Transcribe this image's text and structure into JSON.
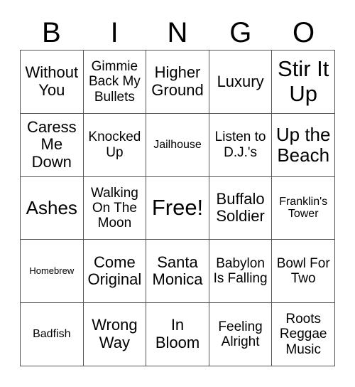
{
  "card": {
    "header_letters": [
      "B",
      "I",
      "N",
      "G",
      "O"
    ],
    "grid": {
      "rows": 5,
      "columns": 5,
      "border_color": "#555555",
      "background_color": "#ffffff",
      "text_color": "#000000"
    },
    "cells": [
      {
        "text": "Without You",
        "size": "l",
        "row": 1,
        "column": "B"
      },
      {
        "text": "Gimmie Back My Bullets",
        "size": "m",
        "row": 1,
        "column": "I"
      },
      {
        "text": "Higher Ground",
        "size": "l",
        "row": 1,
        "column": "N"
      },
      {
        "text": "Luxury",
        "size": "l",
        "row": 1,
        "column": "G"
      },
      {
        "text": "Stir It Up",
        "size": "xxl",
        "row": 1,
        "column": "O"
      },
      {
        "text": "Caress Me Down",
        "size": "l",
        "row": 2,
        "column": "B"
      },
      {
        "text": "Knocked Up",
        "size": "m",
        "row": 2,
        "column": "I"
      },
      {
        "text": "Jailhouse",
        "size": "s",
        "row": 2,
        "column": "N"
      },
      {
        "text": "Listen to D.J.'s",
        "size": "m",
        "row": 2,
        "column": "G"
      },
      {
        "text": "Up the Beach",
        "size": "xl",
        "row": 2,
        "column": "O"
      },
      {
        "text": "Ashes",
        "size": "xl",
        "row": 3,
        "column": "B"
      },
      {
        "text": "Walking On The Moon",
        "size": "m",
        "row": 3,
        "column": "I"
      },
      {
        "text": "Free!",
        "size": "free",
        "row": 3,
        "column": "N"
      },
      {
        "text": "Buffalo Soldier",
        "size": "l",
        "row": 3,
        "column": "G"
      },
      {
        "text": "Franklin's Tower",
        "size": "s",
        "row": 3,
        "column": "O"
      },
      {
        "text": "Homebrew",
        "size": "xs",
        "row": 4,
        "column": "B"
      },
      {
        "text": "Come Original",
        "size": "l",
        "row": 4,
        "column": "I"
      },
      {
        "text": "Santa Monica",
        "size": "l",
        "row": 4,
        "column": "N"
      },
      {
        "text": "Babylon Is Falling",
        "size": "m",
        "row": 4,
        "column": "G"
      },
      {
        "text": "Bowl For Two",
        "size": "m",
        "row": 4,
        "column": "O"
      },
      {
        "text": "Badfish",
        "size": "s",
        "row": 5,
        "column": "B"
      },
      {
        "text": "Wrong Way",
        "size": "l",
        "row": 5,
        "column": "I"
      },
      {
        "text": "In Bloom",
        "size": "l",
        "row": 5,
        "column": "N"
      },
      {
        "text": "Feeling Alright",
        "size": "m",
        "row": 5,
        "column": "G"
      },
      {
        "text": "Roots Reggae Music",
        "size": "m",
        "row": 5,
        "column": "O"
      }
    ]
  }
}
